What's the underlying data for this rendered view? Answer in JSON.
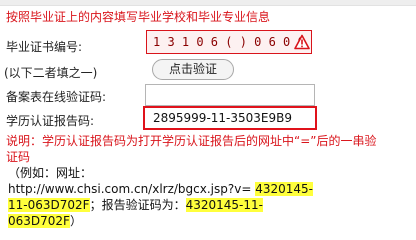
{
  "hint": "按照毕业证上的内容填写毕业学校和毕业专业信息",
  "form": {
    "cert_label": "毕业证书编号:",
    "cert_value": "1 3 1 0 6   (   )   0 6 0   0 5 6",
    "either_label": "(以下二者填之一)",
    "verify_button": "点击验证",
    "online_label": "备案表在线验证码:",
    "online_value": "",
    "report_label": "学历认证报告码:",
    "report_value": "2895999-11-3503E9B9"
  },
  "note": {
    "text": "说明：学历认证报告码为打开学历认证报告后的网址中“=”后的一串验证码"
  },
  "example": {
    "open": "（例如：网址：",
    "url_prefix": "http://www.chsi.com.cn/xlrz/bgcx.jsp?v=",
    "code_part1": "4320145-",
    "code_part2": "11-063D702F",
    "mid_text": "；报告验证码为：",
    "code2_part1": "4320145-11-",
    "code2_part2": "063D702F",
    "close": "）"
  },
  "colors": {
    "error": "#d9141b",
    "highlight": "#ffff3c",
    "input_error_bg": "#fdf1f1"
  },
  "icons": {
    "warning": "warning-icon"
  }
}
